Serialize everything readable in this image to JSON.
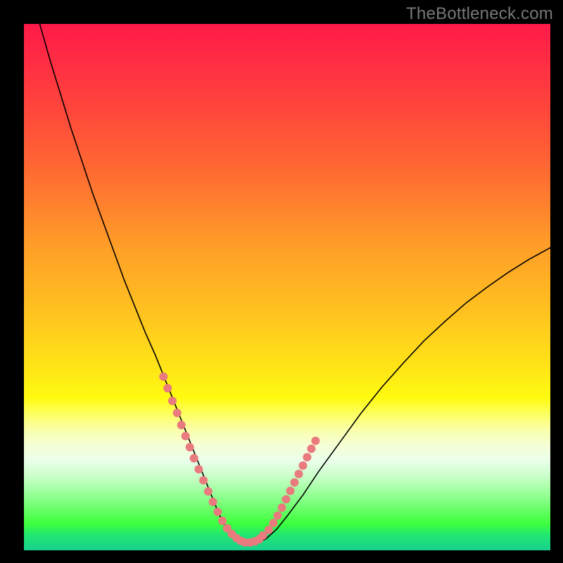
{
  "watermark": "TheBottleneck.com",
  "chart_data": {
    "type": "line",
    "title": "",
    "xlabel": "",
    "ylabel": "",
    "x_range": [
      0,
      100
    ],
    "y_range": [
      0,
      100
    ],
    "series": [
      {
        "name": "bottleneck-curve",
        "x": [
          3,
          5,
          7,
          9,
          11,
          13,
          15,
          17,
          19,
          21,
          23,
          25,
          26,
          27,
          28,
          29,
          30,
          31,
          32,
          33,
          34,
          35,
          36,
          37,
          38,
          39,
          40,
          42,
          44,
          46,
          48,
          50,
          53,
          56,
          60,
          64,
          68,
          72,
          76,
          80,
          84,
          88,
          92,
          96,
          100
        ],
        "y": [
          100,
          93,
          86.5,
          80,
          74,
          68,
          62.5,
          57,
          51.5,
          46.5,
          41.5,
          37,
          34.5,
          32,
          29.5,
          27,
          24.5,
          22,
          19.5,
          17,
          14.5,
          12,
          9.5,
          7,
          5,
          3.5,
          2.2,
          1.2,
          1.2,
          2.2,
          4,
          6.5,
          10.5,
          15,
          20.5,
          26,
          31,
          35.5,
          39.8,
          43.5,
          47,
          50,
          52.8,
          55.3,
          57.5
        ]
      }
    ],
    "markers": {
      "name": "highlight-beads",
      "x": [
        26.5,
        27.3,
        28.2,
        29.1,
        29.9,
        30.7,
        31.5,
        32.3,
        33.2,
        34.1,
        35.0,
        35.9,
        36.8,
        37.7,
        38.6,
        39.5,
        40.4,
        41.2,
        42.0,
        43.0,
        43.9,
        44.7,
        45.4,
        46.5,
        47.4,
        48.2,
        49.0,
        49.8,
        50.6,
        51.4,
        52.2,
        53.0,
        53.8,
        54.6,
        55.4
      ],
      "y": [
        33.0,
        30.8,
        28.4,
        26.1,
        23.8,
        21.7,
        19.6,
        17.5,
        15.4,
        13.3,
        11.2,
        9.2,
        7.3,
        5.6,
        4.2,
        3.1,
        2.3,
        1.8,
        1.5,
        1.5,
        1.7,
        2.1,
        2.8,
        3.9,
        5.2,
        6.6,
        8.1,
        9.7,
        11.3,
        12.9,
        14.5,
        16.1,
        17.7,
        19.3,
        20.8
      ],
      "radius": 6
    },
    "background_gradient": {
      "top": "#ff1a49",
      "mid": "#ffe716",
      "bottom": "#18d08c"
    }
  }
}
